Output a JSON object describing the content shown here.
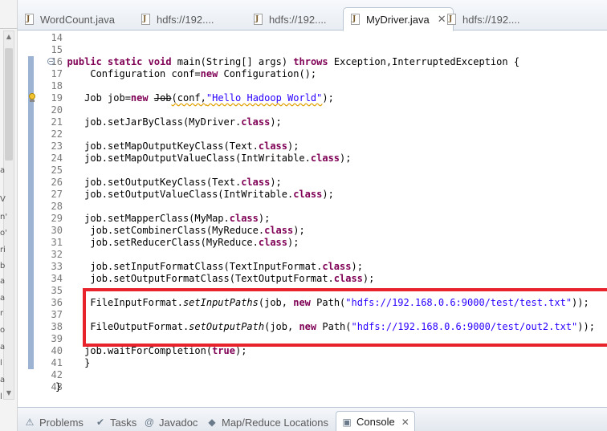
{
  "tabs": [
    {
      "label": "WordCount.java",
      "active": false,
      "closable": false
    },
    {
      "label": "hdfs://192....",
      "active": false,
      "closable": false
    },
    {
      "label": "hdfs://192....",
      "active": false,
      "closable": false
    },
    {
      "label": "MyDriver.java",
      "active": true,
      "closable": true
    },
    {
      "label": "hdfs://192....",
      "active": false,
      "closable": false
    }
  ],
  "left_fragments": [
    "a",
    "V",
    "n'",
    "o'",
    "ri",
    "b",
    "a",
    "a",
    "r",
    "o",
    "a",
    "l",
    "a",
    "l"
  ],
  "lines": [
    {
      "n": "14",
      "segs": []
    },
    {
      "n": "15",
      "segs": []
    },
    {
      "n": "16",
      "fold": true,
      "segs": [
        [
          "  ",
          ""
        ],
        [
          "public",
          "kw"
        ],
        [
          " ",
          ""
        ],
        [
          "static",
          "kw"
        ],
        [
          " ",
          ""
        ],
        [
          "void",
          "kw"
        ],
        [
          " main(String[] args) ",
          ""
        ],
        [
          "throws",
          "kw"
        ],
        [
          " Exception,InterruptedException {",
          ""
        ]
      ]
    },
    {
      "n": "17",
      "segs": [
        [
          "      Configuration conf=",
          ""
        ],
        [
          "new",
          "kw"
        ],
        [
          " Configuration();",
          ""
        ]
      ]
    },
    {
      "n": "18",
      "segs": []
    },
    {
      "n": "19",
      "warn": true,
      "segs": [
        [
          "     Job job=",
          ""
        ],
        [
          "new",
          "kw"
        ],
        [
          " ",
          ""
        ],
        [
          "Job",
          "strike"
        ],
        [
          "(conf,",
          "squig"
        ],
        [
          "\"Hello Hadoop World\"",
          "str squig"
        ],
        [
          ");",
          ""
        ]
      ]
    },
    {
      "n": "20",
      "segs": []
    },
    {
      "n": "21",
      "segs": [
        [
          "     job.setJarByClass(MyDriver.",
          ""
        ],
        [
          "class",
          "kw"
        ],
        [
          ");",
          ""
        ]
      ]
    },
    {
      "n": "22",
      "segs": []
    },
    {
      "n": "23",
      "segs": [
        [
          "     job.setMapOutputKeyClass(Text.",
          ""
        ],
        [
          "class",
          "kw"
        ],
        [
          ");",
          ""
        ]
      ]
    },
    {
      "n": "24",
      "segs": [
        [
          "     job.setMapOutputValueClass(IntWritable.",
          ""
        ],
        [
          "class",
          "kw"
        ],
        [
          ");",
          ""
        ]
      ]
    },
    {
      "n": "25",
      "segs": []
    },
    {
      "n": "26",
      "segs": [
        [
          "     job.setOutputKeyClass(Text.",
          ""
        ],
        [
          "class",
          "kw"
        ],
        [
          ");",
          ""
        ]
      ]
    },
    {
      "n": "27",
      "segs": [
        [
          "     job.setOutputValueClass(IntWritable.",
          ""
        ],
        [
          "class",
          "kw"
        ],
        [
          ");",
          ""
        ]
      ]
    },
    {
      "n": "28",
      "segs": []
    },
    {
      "n": "29",
      "segs": [
        [
          "     job.setMapperClass(MyMap.",
          ""
        ],
        [
          "class",
          "kw"
        ],
        [
          ");",
          ""
        ]
      ]
    },
    {
      "n": "30",
      "segs": [
        [
          "      job.setCombinerClass(MyReduce.",
          ""
        ],
        [
          "class",
          "kw"
        ],
        [
          ");",
          ""
        ]
      ]
    },
    {
      "n": "31",
      "segs": [
        [
          "      job.setReducerClass(MyReduce.",
          ""
        ],
        [
          "class",
          "kw"
        ],
        [
          ");",
          ""
        ]
      ]
    },
    {
      "n": "32",
      "segs": []
    },
    {
      "n": "33",
      "segs": [
        [
          "      job.setInputFormatClass(TextInputFormat.",
          ""
        ],
        [
          "class",
          "kw"
        ],
        [
          ");",
          ""
        ]
      ]
    },
    {
      "n": "34",
      "segs": [
        [
          "      job.setOutputFormatClass(TextOutputFormat.",
          ""
        ],
        [
          "class",
          "kw"
        ],
        [
          ");",
          ""
        ]
      ]
    },
    {
      "n": "35",
      "segs": []
    },
    {
      "n": "36",
      "segs": [
        [
          "      FileInputFormat.",
          ""
        ],
        [
          "setInputPaths",
          "it"
        ],
        [
          "(job, ",
          ""
        ],
        [
          "new",
          "kw"
        ],
        [
          " Path(",
          ""
        ],
        [
          "\"hdfs://192.168.0.6:9000/test/test.txt\"",
          "str"
        ],
        [
          "));",
          ""
        ]
      ]
    },
    {
      "n": "37",
      "segs": []
    },
    {
      "n": "38",
      "segs": [
        [
          "      FileOutputFormat.",
          ""
        ],
        [
          "setOutputPath",
          "it"
        ],
        [
          "(job, ",
          ""
        ],
        [
          "new",
          "kw"
        ],
        [
          " Path(",
          ""
        ],
        [
          "\"hdfs://192.168.0.6:9000/test/out2.txt\"",
          "str"
        ],
        [
          "));",
          ""
        ]
      ]
    },
    {
      "n": "39",
      "segs": []
    },
    {
      "n": "40",
      "segs": [
        [
          "     job.waitForCompletion(",
          ""
        ],
        [
          "true",
          "kw"
        ],
        [
          ");",
          ""
        ]
      ]
    },
    {
      "n": "41",
      "segs": [
        [
          "     }",
          ""
        ]
      ]
    },
    {
      "n": "42",
      "segs": []
    },
    {
      "n": "43",
      "segs": [
        [
          "}",
          ""
        ]
      ]
    }
  ],
  "bottom_tabs": [
    {
      "label": "Problems",
      "icon": "problems-icon",
      "glyph": "⚠",
      "active": false
    },
    {
      "label": "Tasks",
      "icon": "tasks-icon",
      "glyph": "✔",
      "active": false
    },
    {
      "label": "Javadoc",
      "icon": "javadoc-icon",
      "glyph": "@",
      "active": false
    },
    {
      "label": "Map/Reduce Locations",
      "icon": "map-reduce-icon",
      "glyph": "◆",
      "active": false
    },
    {
      "label": "Console",
      "icon": "console-icon",
      "glyph": "▣",
      "active": true,
      "closable": true
    }
  ],
  "colors": {
    "highlight": "#e8232b",
    "keyword": "#7f0055",
    "string": "#2a00ff"
  }
}
